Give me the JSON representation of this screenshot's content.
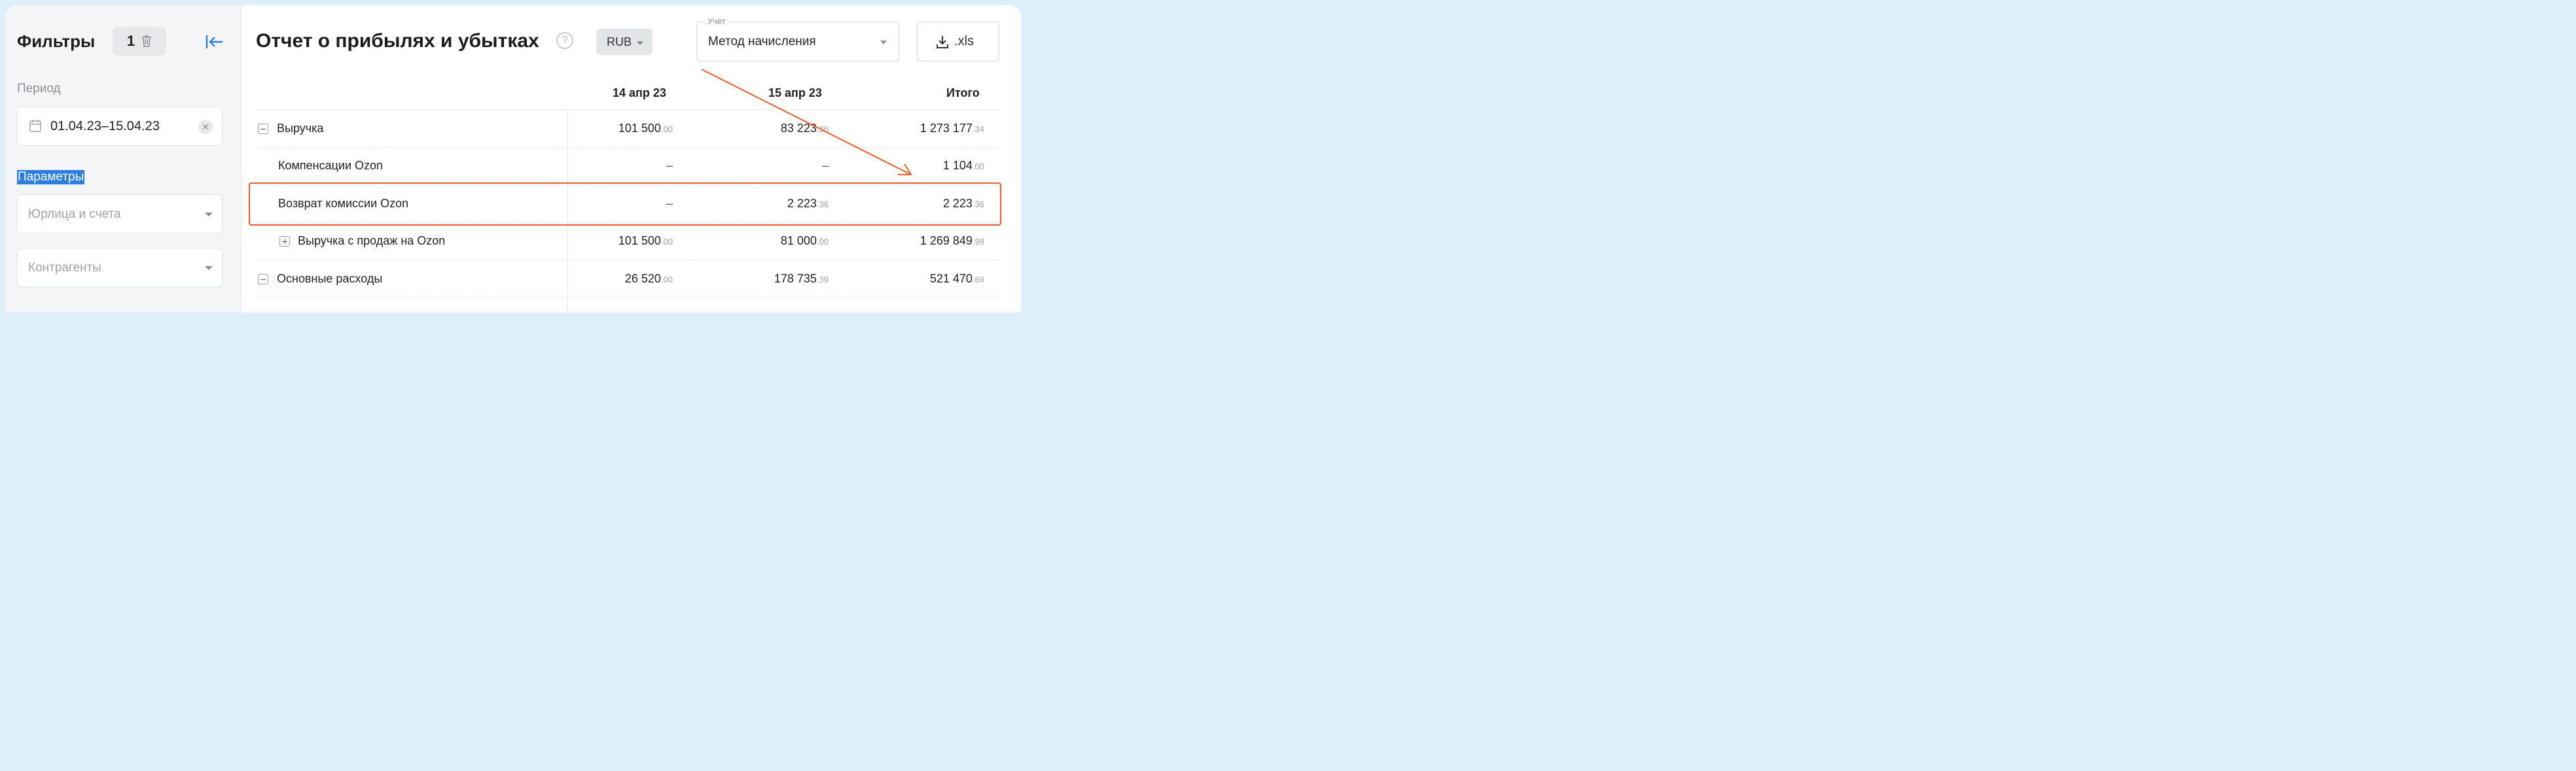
{
  "sidebar": {
    "title": "Фильтры",
    "filter_count": "1",
    "period_label": "Период",
    "period_value": "01.04.23–15.04.23",
    "clear_symbol": "✕",
    "params_label": "Параметры",
    "legal_placeholder": "Юрлица и счета",
    "counterparties_placeholder": "Контрагенты"
  },
  "header": {
    "title": "Отчет о прибылях и убытках",
    "help_symbol": "?",
    "currency": "RUB",
    "accounting_label": "Учет",
    "accounting_value": "Метод начисления",
    "export_label": ".xls"
  },
  "table": {
    "columns": [
      "14 апр 23",
      "15 апр 23",
      "Итого"
    ],
    "rows": [
      {
        "label": "Выручка",
        "toggle": "minus",
        "values": [
          [
            "101 500",
            ".00"
          ],
          [
            "83 223",
            ".36"
          ],
          [
            "1 273 177",
            ".34"
          ]
        ]
      },
      {
        "label": "Компенсации Ozon",
        "values": [
          [
            "–",
            ""
          ],
          [
            "–",
            ""
          ],
          [
            "1 104",
            ".00"
          ]
        ]
      },
      {
        "label": "Возврат комиссии Ozon",
        "values": [
          [
            "–",
            ""
          ],
          [
            "2 223",
            ".36"
          ],
          [
            "2 223",
            ".36"
          ]
        ]
      },
      {
        "label": "Выручка с продаж на Ozon",
        "toggle": "plus",
        "values": [
          [
            "101 500",
            ".00"
          ],
          [
            "81 000",
            ".00"
          ],
          [
            "1 269 849",
            ".98"
          ]
        ]
      },
      {
        "label": "Основные расходы",
        "toggle": "minus",
        "values": [
          [
            "26 520",
            ".00"
          ],
          [
            "178 735",
            ".39"
          ],
          [
            "521 470",
            ".69"
          ]
        ]
      }
    ]
  },
  "icons": {
    "trash": "trash-icon",
    "collapse": "collapse-left-icon",
    "calendar": "calendar-icon",
    "download": "download-icon",
    "help": "help-icon"
  },
  "colors": {
    "accent": "#2b7de0",
    "annotation": "#ef5d2a",
    "page_background": "#ddeff8"
  }
}
